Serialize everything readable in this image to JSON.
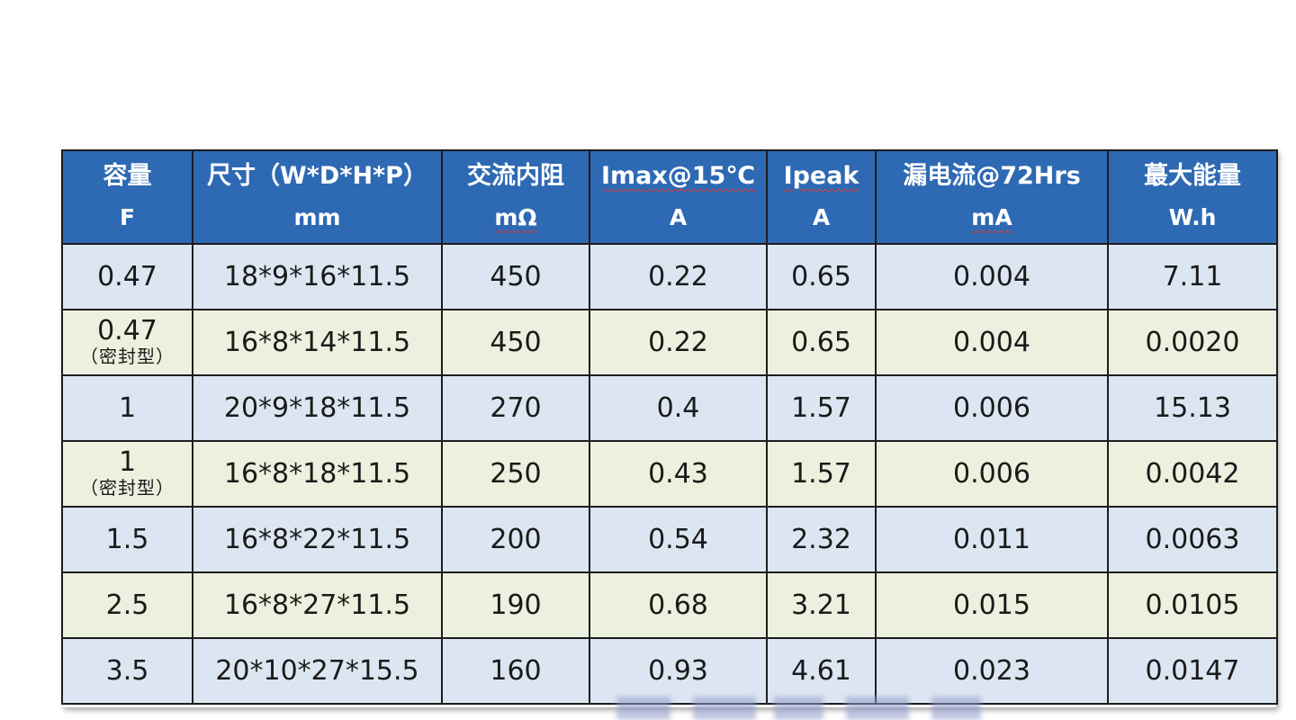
{
  "table": {
    "headers": [
      {
        "line1": "容量",
        "line2": "F"
      },
      {
        "line1": "尺寸（W*D*H*P）",
        "line2": "mm"
      },
      {
        "line1": "交流内阻",
        "line2": "mΩ"
      },
      {
        "line1": "Imax@15℃",
        "line2": "A"
      },
      {
        "line1": "Ipeak",
        "line2": "A"
      },
      {
        "line1": "漏电流@72Hrs",
        "line2": "mA"
      },
      {
        "line1": "蕞大能量",
        "line2": "W.h"
      }
    ],
    "rows": [
      {
        "capacity": "0.47",
        "note": "",
        "size": "18*9*16*11.5",
        "esr": "450",
        "imax": "0.22",
        "ipeak": "0.65",
        "leak": "0.004",
        "energy": "7.11"
      },
      {
        "capacity": "0.47",
        "note": "（密封型）",
        "size": "16*8*14*11.5",
        "esr": "450",
        "imax": "0.22",
        "ipeak": "0.65",
        "leak": "0.004",
        "energy": "0.0020"
      },
      {
        "capacity": "1",
        "note": "",
        "size": "20*9*18*11.5",
        "esr": "270",
        "imax": "0.4",
        "ipeak": "1.57",
        "leak": "0.006",
        "energy": "15.13"
      },
      {
        "capacity": "1",
        "note": "（密封型）",
        "size": "16*8*18*11.5",
        "esr": "250",
        "imax": "0.43",
        "ipeak": "1.57",
        "leak": "0.006",
        "energy": "0.0042"
      },
      {
        "capacity": "1.5",
        "note": "",
        "size": "16*8*22*11.5",
        "esr": "200",
        "imax": "0.54",
        "ipeak": "2.32",
        "leak": "0.011",
        "energy": "0.0063"
      },
      {
        "capacity": "2.5",
        "note": "",
        "size": "16*8*27*11.5",
        "esr": "190",
        "imax": "0.68",
        "ipeak": "3.21",
        "leak": "0.015",
        "energy": "0.0105"
      },
      {
        "capacity": "3.5",
        "note": "",
        "size": "20*10*27*15.5",
        "esr": "160",
        "imax": "0.93",
        "ipeak": "4.61",
        "leak": "0.023",
        "energy": "0.0147"
      }
    ]
  },
  "colors": {
    "header_bg": "#2e69b3",
    "row_blue": "#dce6f2",
    "row_green": "#ebf1de",
    "border": "#1d1d1d"
  }
}
